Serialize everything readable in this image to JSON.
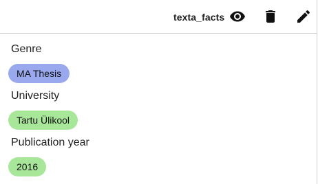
{
  "toolbar": {
    "fact_name": "texta_facts",
    "icons": {
      "view": "eye-icon",
      "delete": "trash-icon",
      "edit": "pencil-icon"
    }
  },
  "fields": [
    {
      "label": "Genre",
      "value": "MA Thesis",
      "chip_color": "#9aa9ee"
    },
    {
      "label": "University",
      "value": "Tartu Ülikool",
      "chip_color": "#a8e69a"
    },
    {
      "label": "Publication year",
      "value": "2016",
      "chip_color": "#a8e69a"
    }
  ]
}
